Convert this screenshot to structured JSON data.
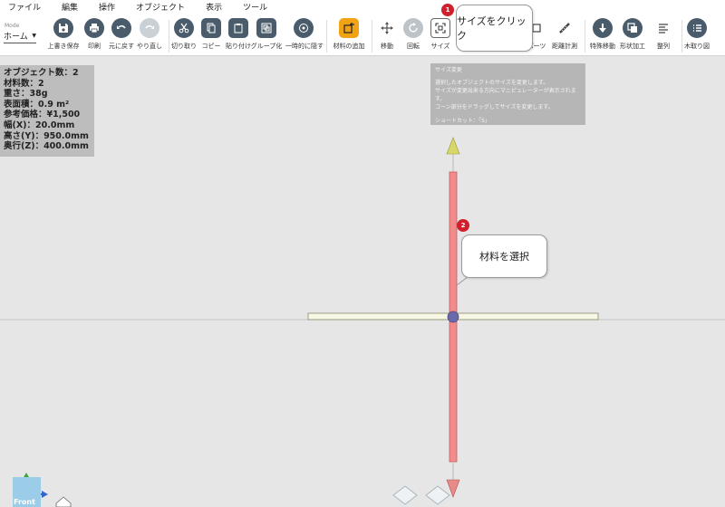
{
  "menu": [
    "ファイル",
    "編集",
    "操作",
    "オブジェクト",
    "表示",
    "ツール"
  ],
  "mode": {
    "label": "Mode",
    "value": "ホーム"
  },
  "toolbar": {
    "save": "上書き保存",
    "print": "印刷",
    "undo": "元に戻す",
    "redo": "やり直し",
    "cut": "切り取り",
    "copy": "コピー",
    "paste": "貼り付け",
    "group": "グループ化",
    "hide": "一時的に隠す",
    "add_material": "材料の追加",
    "move": "移動",
    "rotate": "回転",
    "size": "サイズ",
    "parts": "パーツ",
    "measure": "距離計測",
    "special_move": "特殊移動",
    "shape": "形状加工",
    "align": "整列",
    "cut_plan": "木取り図"
  },
  "info": {
    "objects": "オブジェクト数：2",
    "materials": "材料数：2",
    "weight": "重さ：38g",
    "area": "表面積：0.9 m²",
    "price": "参考価格：¥1,500",
    "width": "幅(X)：20.0mm",
    "height": "高さ(Y)：950.0mm",
    "depth": "奥行(Z)：400.0mm"
  },
  "tooltip": {
    "title": "サイズ変更",
    "line1": "選択したオブジェクトのサイズを変更します。",
    "line2": "サイズが変更出来る方向にマニピュレーターが表示されます。",
    "line3": "コーン部分をドラッグしてサイズを変更します。",
    "shortcut": "ショートカット：「S」"
  },
  "callouts": {
    "c1_text": "サイズをクリック",
    "c1_num": "1",
    "c2_text": "材料を選択",
    "c2_num": "2"
  },
  "viewcube": {
    "label": "Front"
  },
  "colors": {
    "icon_dark": "#4a5c6b",
    "icon_orange": "#f2a313",
    "material_red": "#f08c8c",
    "board": "#f8f7e4",
    "badge": "#d0202e"
  }
}
